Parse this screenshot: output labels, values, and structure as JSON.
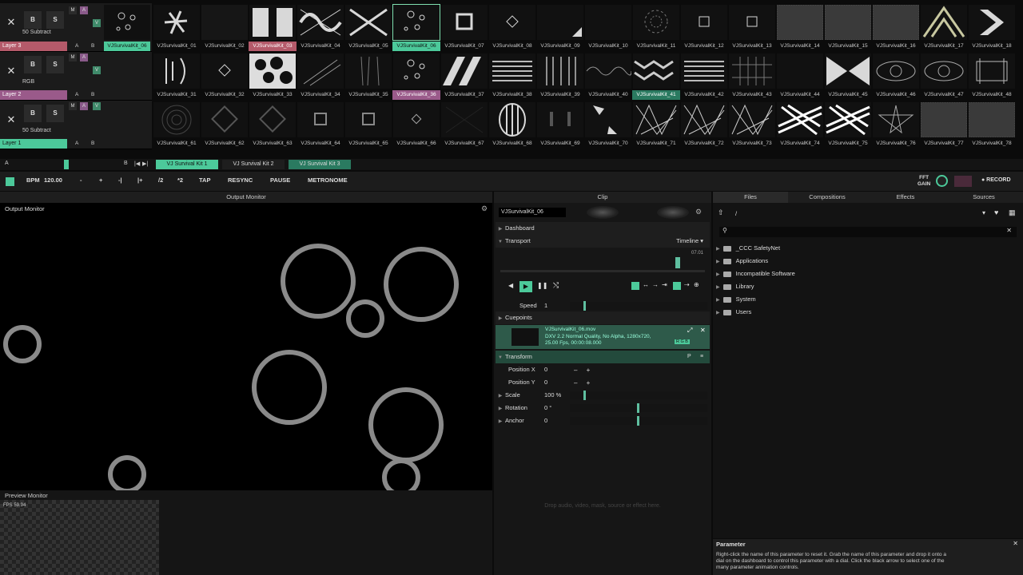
{
  "layers": [
    {
      "name": "Layer 3",
      "mode": "50 Subtract",
      "color": "#b45a6a",
      "b": "B",
      "s": "S",
      "a": "A",
      "bb": "B",
      "m": "M",
      "ma": "A",
      "v": "V"
    },
    {
      "name": "Layer 2",
      "mode": "RGB",
      "color": "#9a5a8a",
      "b": "B",
      "s": "S",
      "a": "A",
      "bb": "B",
      "m": "M",
      "ma": "A",
      "v": "V"
    },
    {
      "name": "Layer 1",
      "mode": "50 Subtract",
      "color": "#4cc99a",
      "b": "B",
      "s": "S",
      "a": "A",
      "bb": "B",
      "m": "M",
      "ma": "A",
      "v": "V"
    }
  ],
  "layer3_slot_label": "VJSurvivalKit_06",
  "row1": [
    "VJSurvivalKit_01",
    "VJSurvivalKit_02",
    "VJSurvivalKit_03",
    "VJSurvivalKit_04",
    "VJSurvivalKit_05",
    "VJSurvivalKit_06",
    "VJSurvivalKit_07",
    "VJSurvivalKit_08",
    "VJSurvivalKit_09",
    "VJSurvivalKit_10",
    "VJSurvivalKit_11",
    "VJSurvivalKit_12",
    "VJSurvivalKit_13",
    "VJSurvivalKit_14",
    "VJSurvivalKit_15",
    "VJSurvivalKit_16",
    "VJSurvivalKit_17",
    "VJSurvivalKit_18"
  ],
  "row2": [
    "VJSurvivalKit_31",
    "VJSurvivalKit_32",
    "VJSurvivalKit_33",
    "VJSurvivalKit_34",
    "VJSurvivalKit_35",
    "VJSurvivalKit_36",
    "VJSurvivalKit_37",
    "VJSurvivalKit_38",
    "VJSurvivalKit_39",
    "VJSurvivalKit_40",
    "VJSurvivalKit_41",
    "VJSurvivalKit_42",
    "VJSurvivalKit_43",
    "VJSurvivalKit_44",
    "VJSurvivalKit_45",
    "VJSurvivalKit_46",
    "VJSurvivalKit_47",
    "VJSurvivalKit_48"
  ],
  "row3": [
    "VJSurvivalKit_61",
    "VJSurvivalKit_62",
    "VJSurvivalKit_63",
    "VJSurvivalKit_64",
    "VJSurvivalKit_65",
    "VJSurvivalKit_66",
    "VJSurvivalKit_67",
    "VJSurvivalKit_68",
    "VJSurvivalKit_69",
    "VJSurvivalKit_70",
    "VJSurvivalKit_71",
    "VJSurvivalKit_72",
    "VJSurvivalKit_73",
    "VJSurvivalKit_74",
    "VJSurvivalKit_75",
    "VJSurvivalKit_76",
    "VJSurvivalKit_77",
    "VJSurvivalKit_78"
  ],
  "deck": {
    "a": "A",
    "b": "B",
    "prev": "|◀",
    "next": "▶|",
    "tabs": [
      "VJ Survival Kit 1",
      "VJ Survival Kit 2",
      "VJ Survival Kit 3"
    ]
  },
  "toolbar": {
    "bpm_label": "BPM",
    "bpm": "120.00",
    "minus": "-",
    "plus": "+",
    "nudge_minus": "-|",
    "nudge_plus": "|+",
    "half": "/2",
    "double": "*2",
    "tap": "TAP",
    "resync": "RESYNC",
    "pause": "PAUSE",
    "metronome": "METRONOME",
    "fft": "FFT",
    "gain": "GAIN",
    "record": "● RECORD"
  },
  "output": {
    "header": "Output Monitor",
    "title": "Output Monitor"
  },
  "preview": {
    "title": "Preview Monitor",
    "fps": "FPS 59.94"
  },
  "clip": {
    "header": "Clip",
    "name": "VJSurvivalKit_06",
    "dashboard": "Dashboard",
    "transport": "Transport",
    "timeline": "Timeline",
    "time": "07.01",
    "speed_label": "Speed",
    "speed": "1",
    "cuepoints": "Cuepoints",
    "file": "VJSurvivalKit_06.mov",
    "info1": "DXV 2.2 Normal Quality, No Alpha, 1280x720,",
    "info2": "25.00 Fps, 00:00:08.000",
    "rgb": "R G B",
    "transform": "Transform",
    "params": [
      {
        "label": "Position X",
        "value": "0",
        "tri": false
      },
      {
        "label": "Position Y",
        "value": "0",
        "tri": false
      },
      {
        "label": "Scale",
        "value": "100 %",
        "tri": true
      },
      {
        "label": "Rotation",
        "value": "0 °",
        "tri": true
      },
      {
        "label": "Anchor",
        "value": "0",
        "tri": true
      }
    ],
    "dropzone": "Drop audio, video, mask, source or effect here."
  },
  "browser": {
    "tabs": [
      "Files",
      "Compositions",
      "Effects",
      "Sources"
    ],
    "path": "/",
    "folders": [
      "_CCC SafetyNet",
      "Applications",
      "Incompatible Software",
      "Library",
      "System",
      "Users"
    ]
  },
  "parameter": {
    "title": "Parameter",
    "text": "Right-click the name of this parameter to reset it. Grab the name of this parameter and drop it onto a dial on the dashboard to control this parameter with a dial. Click the black arrow to select one of the many parameter animation controls."
  }
}
